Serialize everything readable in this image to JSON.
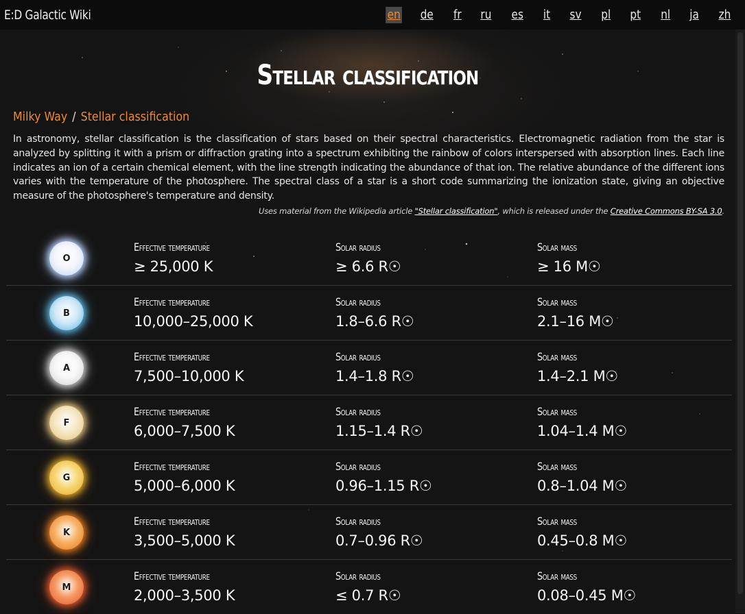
{
  "site": {
    "brand": "E:D Galactic Wiki"
  },
  "languages": [
    {
      "code": "en",
      "active": true
    },
    {
      "code": "de"
    },
    {
      "code": "fr"
    },
    {
      "code": "ru"
    },
    {
      "code": "es"
    },
    {
      "code": "it"
    },
    {
      "code": "sv"
    },
    {
      "code": "pl"
    },
    {
      "code": "pt"
    },
    {
      "code": "nl"
    },
    {
      "code": "ja"
    },
    {
      "code": "zh"
    }
  ],
  "page": {
    "title": "Stellar classification",
    "breadcrumb": {
      "parent": "Milky Way",
      "separator": "/",
      "current": "Stellar classification"
    },
    "intro": "In astronomy, stellar classification is the classification of stars based on their spectral characteristics. Electromagnetic radiation from the star is analyzed by splitting it with a prism or diffraction grating into a spectrum exhibiting the rainbow of colors interspersed with absorption lines. Each line indicates an ion of a certain chemical element, with the line strength indicating the abundance of that ion. The relative abundance of the different ions varies with the temperature of the photosphere. The spectral class of a star is a short code summarizing the ionization state, giving an objective measure of the photosphere's temperature and density.",
    "attribution": {
      "prefix": "Uses material from the Wikipedia article ",
      "article": "\"Stellar classification\"",
      "middle": ", which is released under the ",
      "license": "Creative Commons BY-SA 3.0",
      "suffix": "."
    }
  },
  "labels": {
    "temperature": "Effective temperature",
    "radius": "Solar radius",
    "mass": "Solar mass"
  },
  "classes": [
    {
      "letter": "O",
      "temperature": "≥ 25,000 K",
      "radius": "≥ 6.6 R☉",
      "mass": "≥ 16 M☉",
      "core": "#f4f6fa",
      "glow": "#b9d3ff"
    },
    {
      "letter": "B",
      "temperature": "10,000–25,000 K",
      "radius": "1.8–6.6 R☉",
      "mass": "2.1–16 M☉",
      "core": "#cfe9f7",
      "glow": "#5fb4e0"
    },
    {
      "letter": "A",
      "temperature": "7,500–10,000 K",
      "radius": "1.4–1.8 R☉",
      "mass": "1.4–2.1 M☉",
      "core": "#f7f7f7",
      "glow": "#d0d0d0"
    },
    {
      "letter": "F",
      "temperature": "6,000–7,500 K",
      "radius": "1.15–1.4 R☉",
      "mass": "1.04–1.4 M☉",
      "core": "#f6e7c3",
      "glow": "#e2c27e"
    },
    {
      "letter": "G",
      "temperature": "5,000–6,000 K",
      "radius": "0.96–1.15 R☉",
      "mass": "0.8–1.04 M☉",
      "core": "#f7d774",
      "glow": "#e7a92a"
    },
    {
      "letter": "K",
      "temperature": "3,500–5,000 K",
      "radius": "0.7–0.96 R☉",
      "mass": "0.45–0.8 M☉",
      "core": "#f7b266",
      "glow": "#e57a1f"
    },
    {
      "letter": "M",
      "temperature": "2,000–3,500 K",
      "radius": "≤ 0.7 R☉",
      "mass": "0.08–0.45 M☉",
      "core": "#f59a63",
      "glow": "#e2582a"
    }
  ]
}
